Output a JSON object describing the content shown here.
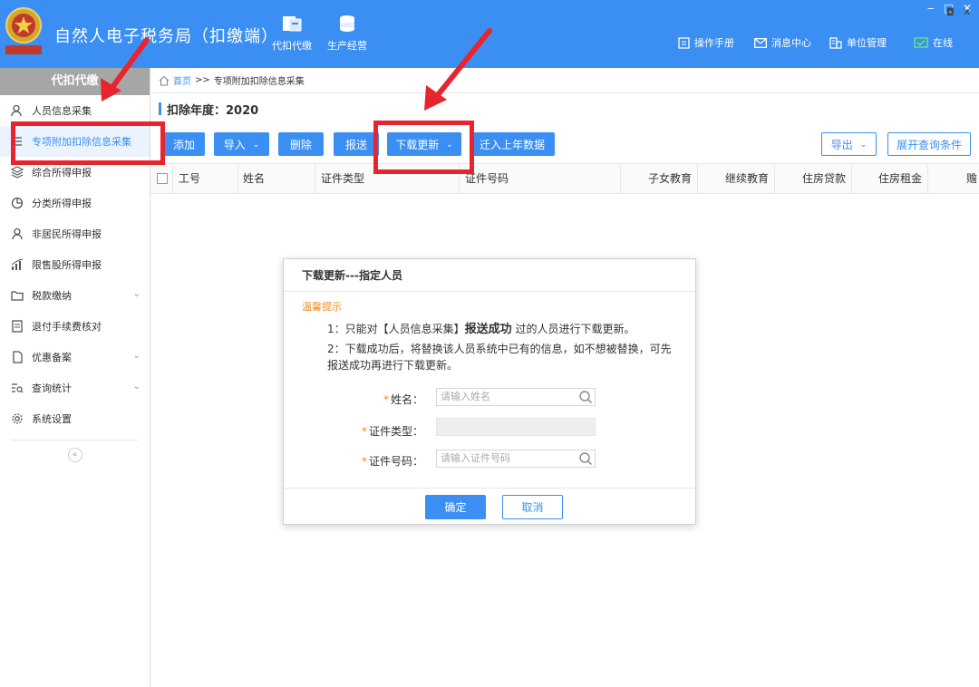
{
  "header": {
    "app_title": "自然人电子税务局（扣缴端）",
    "emblem_text": "中国税务",
    "nav": [
      {
        "label": "代扣代缴",
        "icon": "folder-icon"
      },
      {
        "label": "生产经营",
        "icon": "database-icon"
      }
    ],
    "links": [
      {
        "label": "操作手册",
        "icon": "manual-icon"
      },
      {
        "label": "消息中心",
        "icon": "mail-icon"
      },
      {
        "label": "单位管理",
        "icon": "building-icon"
      },
      {
        "label": "在线",
        "icon": "online-icon"
      }
    ],
    "window_controls": [
      "‒",
      "□",
      "✕"
    ]
  },
  "sidebar": {
    "header": "代扣代缴",
    "items": [
      {
        "label": "人员信息采集",
        "icon": "person-icon",
        "has_chevron": false,
        "active": false
      },
      {
        "label": "专项附加扣除信息采集",
        "icon": "list-icon",
        "has_chevron": false,
        "active": true
      },
      {
        "label": "综合所得申报",
        "icon": "layers-icon",
        "has_chevron": false,
        "active": false
      },
      {
        "label": "分类所得申报",
        "icon": "pie-icon",
        "has_chevron": false,
        "active": false
      },
      {
        "label": "非居民所得申报",
        "icon": "user-icon",
        "has_chevron": false,
        "active": false
      },
      {
        "label": "限售股所得申报",
        "icon": "bars-icon",
        "has_chevron": false,
        "active": false
      },
      {
        "label": "税款缴纳",
        "icon": "folder-icon",
        "has_chevron": true,
        "active": false
      },
      {
        "label": "退付手续费核对",
        "icon": "doc-icon",
        "has_chevron": false,
        "active": false
      },
      {
        "label": "优惠备案",
        "icon": "file-icon",
        "has_chevron": true,
        "active": false
      },
      {
        "label": "查询统计",
        "icon": "search-list-icon",
        "has_chevron": true,
        "active": false
      },
      {
        "label": "系统设置",
        "icon": "gear-icon",
        "has_chevron": false,
        "active": false
      }
    ],
    "collapse_label": "«"
  },
  "breadcrumb": {
    "home": "首页",
    "separator": ">>",
    "current": "专项附加扣除信息采集",
    "controls": [
      "◘",
      "✕"
    ]
  },
  "page": {
    "year_label": "扣除年度：2020"
  },
  "toolbar": {
    "add": "添加",
    "import": "导入",
    "delete": "删除",
    "submit": "报送",
    "download_update": "下载更新",
    "migrate": "迁入上年数据",
    "export": "导出",
    "expand_query": "展开查询条件"
  },
  "table": {
    "columns": [
      "工号",
      "姓名",
      "证件类型",
      "证件号码",
      "子女教育",
      "继续教育",
      "住房贷款",
      "住房租金",
      "赡"
    ],
    "rows": []
  },
  "modal": {
    "title": "下载更新---指定人员",
    "tip_label": "温馨提示",
    "tip1_prefix": "1：只能对【人员信息采集】",
    "tip1_bold": "报送成功",
    "tip1_suffix": "过的人员进行下载更新。",
    "tip2": "2：下载成功后，将替换该人员系统中已有的信息，如不想被替换，可先报送成功再进行下载更新。",
    "fields": {
      "name_label": "姓名：",
      "name_placeholder": "请输入姓名",
      "idtype_label": "证件类型：",
      "idno_label": "证件号码：",
      "idno_placeholder": "请输入证件号码",
      "required_mark": "*"
    },
    "ok": "确定",
    "cancel": "取消"
  },
  "colors": {
    "primary": "#3b8ff2",
    "header_bg": "#3b8ff2",
    "sidebar_head": "#a6a6a6",
    "tip_orange": "#f08a24",
    "annotation_red": "#e8252f"
  }
}
